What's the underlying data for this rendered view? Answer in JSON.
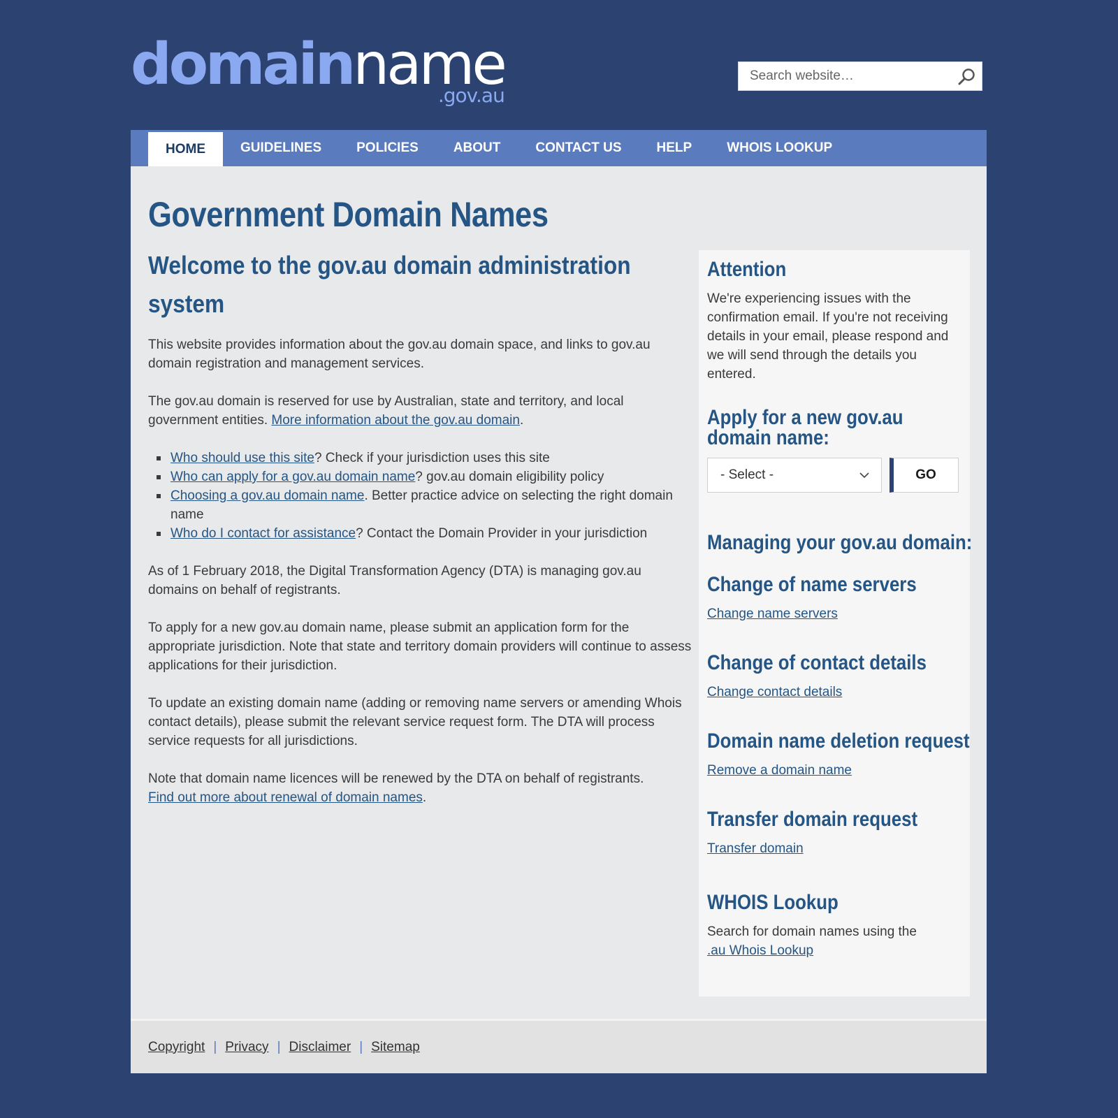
{
  "header": {
    "logo_domain": "domain",
    "logo_name": "name",
    "logo_sub": ".gov.au",
    "search_placeholder": "Search website…",
    "search_icon": "search-icon"
  },
  "nav": {
    "items": [
      "HOME",
      "GUIDELINES",
      "POLICIES",
      "ABOUT",
      "CONTACT US",
      "HELP",
      "WHOIS LOOKUP"
    ],
    "active": "HOME"
  },
  "main": {
    "title": "Government Domain Names",
    "welcome": "Welcome to the gov.au domain administration system",
    "p1": "This website provides information about the gov.au domain space, and links to gov.au domain registration and management services.",
    "p2_text": "The gov.au domain is reserved for use by Australian, state and territory, and local government entities. ",
    "p2_link": "More information about the gov.au domain",
    "p2_end": ".",
    "bullets": [
      {
        "link": "Who should use this site",
        "text": "? Check if your jurisdiction uses this site"
      },
      {
        "link": "Who can apply for a gov.au domain name",
        "text": "? gov.au domain eligibility policy"
      },
      {
        "link": "Choosing a gov.au domain name",
        "text": ". Better practice advice on selecting the right domain name"
      },
      {
        "link": "Who do I contact for assistance",
        "text": "? Contact the Domain Provider in your jurisdiction"
      }
    ],
    "p3": "As of 1 February 2018, the Digital Transformation Agency (DTA)  is managing gov.au domains on behalf of registrants.",
    "p4": "To apply for a new gov.au domain name, please submit an application form for the appropriate jurisdiction. Note that state and territory domain providers will continue to assess applications for their jurisdiction.",
    "p5": "To update an existing domain name (adding or removing name servers or amending Whois contact details), please submit the relevant service request form. The DTA will process service requests for all jurisdictions.",
    "p6_text": "Note that domain name licences will be renewed by the DTA on behalf of registrants.",
    "p6_link": "Find out more about renewal of domain names",
    "p6_end": "."
  },
  "sidebar": {
    "attention_title": "Attention",
    "attention_text": "We're experiencing issues with the confirmation email. If you're not receiving details in your email, please respond and we will send through the details you entered.",
    "apply_title": "Apply for a new gov.au domain name:",
    "select_value": "- Select -",
    "go_label": "GO",
    "managing_title": "Managing your gov.au domain:",
    "sections": [
      {
        "title": "Change of name servers",
        "link": "Change name servers"
      },
      {
        "title": "Change of contact details",
        "link": "Change contact details"
      },
      {
        "title": "Domain name deletion request",
        "link": "Remove a domain name"
      },
      {
        "title": "Transfer domain request",
        "link": "Transfer domain"
      }
    ],
    "whois_title": "WHOIS Lookup",
    "whois_text": "Search for domain names using the",
    "whois_link": ".au Whois Lookup"
  },
  "footer": {
    "links": [
      "Copyright",
      "Privacy",
      "Disclaimer",
      "Sitemap"
    ],
    "separator": "|"
  },
  "colors": {
    "background": "#2c4271",
    "nav": "#5a7bbe",
    "heading": "#255584",
    "logo_accent": "#8aa9f1"
  }
}
